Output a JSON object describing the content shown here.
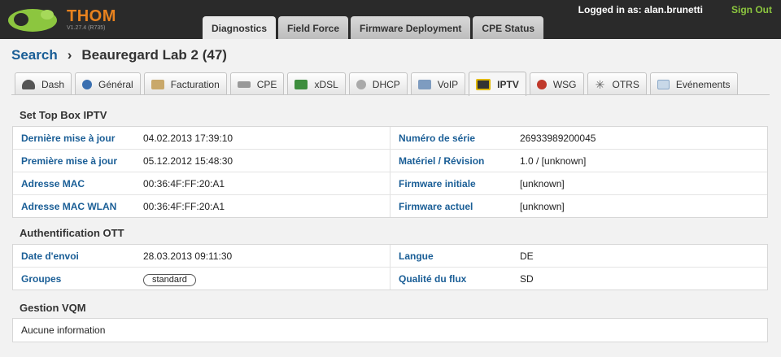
{
  "app": {
    "title": "THOM",
    "version": "V1.27.4 (R735)",
    "logged_in_label": "Logged in as: alan.brunetti",
    "signout_label": "Sign Out"
  },
  "main_tabs": [
    {
      "label": "Diagnostics"
    },
    {
      "label": "Field Force"
    },
    {
      "label": "Firmware Deployment"
    },
    {
      "label": "CPE Status"
    }
  ],
  "breadcrumb": {
    "search": "Search",
    "separator": "›",
    "current": "Beauregard Lab 2 (47)"
  },
  "sub_tabs": [
    {
      "label": "Dash",
      "icon": "gauge-icon",
      "color": "#555555"
    },
    {
      "label": "Général",
      "icon": "user-icon",
      "color": "#3a6fb0"
    },
    {
      "label": "Facturation",
      "icon": "invoice-icon",
      "color": "#b08a4a"
    },
    {
      "label": "CPE",
      "icon": "modem-icon",
      "color": "#8a8a8a"
    },
    {
      "label": "xDSL",
      "icon": "chip-icon",
      "color": "#3e8e3e"
    },
    {
      "label": "DHCP",
      "icon": "gear-icon",
      "color": "#9a9a9a"
    },
    {
      "label": "VoIP",
      "icon": "phone-icon",
      "color": "#6a8ab0"
    },
    {
      "label": "IPTV",
      "icon": "tv-icon",
      "color": "#333333"
    },
    {
      "label": "WSG",
      "icon": "globe-icon",
      "color": "#c0392b"
    },
    {
      "label": "OTRS",
      "icon": "star-icon",
      "color": "#666666"
    },
    {
      "label": "Evénements",
      "icon": "mail-icon",
      "color": "#8aa8c8"
    }
  ],
  "sections": {
    "stb": {
      "title": "Set Top Box IPTV",
      "rows": [
        {
          "l1": "Dernière mise à jour",
          "v1": "04.02.2013 17:39:10",
          "l2": "Numéro de série",
          "v2": "26933989200045"
        },
        {
          "l1": "Première mise à jour",
          "v1": "05.12.2012 15:48:30",
          "l2": "Matériel / Révision",
          "v2": "1.0 / [unknown]"
        },
        {
          "l1": "Adresse MAC",
          "v1": "00:36:4F:FF:20:A1",
          "l2": "Firmware initiale",
          "v2": "[unknown]"
        },
        {
          "l1": "Adresse MAC WLAN",
          "v1": "00:36:4F:FF:20:A1",
          "l2": "Firmware actuel",
          "v2": "[unknown]"
        }
      ]
    },
    "ott": {
      "title": "Authentification OTT",
      "rows": [
        {
          "l1": "Date d'envoi",
          "v1": "28.03.2013 09:11:30",
          "l2": "Langue",
          "v2": "DE"
        },
        {
          "l1": "Groupes",
          "v1": "standard",
          "l2": "Qualité du flux",
          "v2": "SD"
        }
      ]
    },
    "vqm": {
      "title": "Gestion VQM",
      "text": "Aucune information"
    }
  }
}
